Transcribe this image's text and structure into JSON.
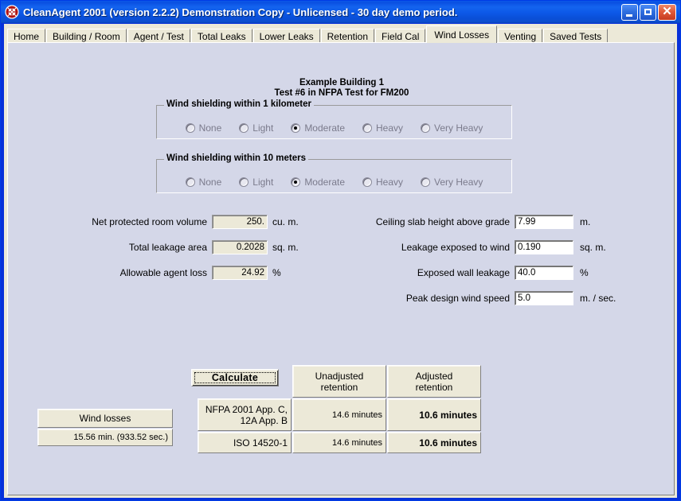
{
  "window": {
    "title": "CleanAgent 2001 (version 2.2.2) Demonstration Copy - Unlicensed - 30 day demo period.",
    "icon": "sprinkler-icon",
    "minimize_label": "",
    "maximize_label": "",
    "close_label": "✕",
    "accent_color": "#0831d9",
    "client_color": "#ece9d8",
    "page_color": "#d4d7e8"
  },
  "tabs": [
    {
      "label": "Home",
      "selected": false
    },
    {
      "label": "Building / Room",
      "selected": false
    },
    {
      "label": "Agent / Test",
      "selected": false
    },
    {
      "label": "Total Leaks",
      "selected": false
    },
    {
      "label": "Lower Leaks",
      "selected": false
    },
    {
      "label": "Retention",
      "selected": false
    },
    {
      "label": "Field Cal",
      "selected": false
    },
    {
      "label": "Wind Losses",
      "selected": true
    },
    {
      "label": "Venting",
      "selected": false
    },
    {
      "label": "Saved Tests",
      "selected": false
    }
  ],
  "header": {
    "line1": "Example Building 1",
    "line2": "Test #6 in NFPA Test for FM200"
  },
  "groups": [
    {
      "title": "Wind shielding within 1 kilometer",
      "options": [
        {
          "label": "None",
          "checked": false
        },
        {
          "label": "Light",
          "checked": false
        },
        {
          "label": "Moderate",
          "checked": true
        },
        {
          "label": "Heavy",
          "checked": false
        },
        {
          "label": "Very Heavy",
          "checked": false
        }
      ]
    },
    {
      "title": "Wind shielding within 10 meters",
      "options": [
        {
          "label": "None",
          "checked": false
        },
        {
          "label": "Light",
          "checked": false
        },
        {
          "label": "Moderate",
          "checked": true
        },
        {
          "label": "Heavy",
          "checked": false
        },
        {
          "label": "Very Heavy",
          "checked": false
        }
      ]
    }
  ],
  "left_fields": [
    {
      "label": "Net protected room volume",
      "value": "250.",
      "unit": "cu.  m.",
      "readonly": true
    },
    {
      "label": "Total leakage area",
      "value": "0.2028",
      "unit": "sq.  m.",
      "readonly": true
    },
    {
      "label": "Allowable agent loss",
      "value": "24.92",
      "unit": "%",
      "readonly": true
    }
  ],
  "right_fields": [
    {
      "label": "Ceiling slab height above grade",
      "value": "7.99",
      "unit": "m.",
      "readonly": false
    },
    {
      "label": "Leakage exposed to wind",
      "value": "0.190",
      "unit": "sq. m.",
      "readonly": false
    },
    {
      "label": "Exposed wall leakage",
      "value": "40.0",
      "unit": "%",
      "readonly": false
    },
    {
      "label": "Peak design wind speed",
      "value": "5.0",
      "unit": "m. / sec.",
      "readonly": false
    }
  ],
  "calculate": {
    "label": "Calculate"
  },
  "results": {
    "columns": [
      "Unadjusted retention",
      "Adjusted retention"
    ],
    "col_header_1_line1": "Unadjusted",
    "col_header_1_line2": "retention",
    "col_header_2_line1": "Adjusted",
    "col_header_2_line2": "retention",
    "rows": [
      {
        "standard_line1": "NFPA 2001 App. C,",
        "standard_line2": "12A App. B",
        "unadjusted": "14.6 minutes",
        "adjusted": "10.6 minutes"
      },
      {
        "standard_line1": "ISO 14520-1",
        "standard_line2": "",
        "unadjusted": "14.6 minutes",
        "adjusted": "10.6 minutes"
      }
    ]
  },
  "wind_losses": {
    "title": "Wind losses",
    "value": "15.56 min. (933.52 sec.)"
  }
}
